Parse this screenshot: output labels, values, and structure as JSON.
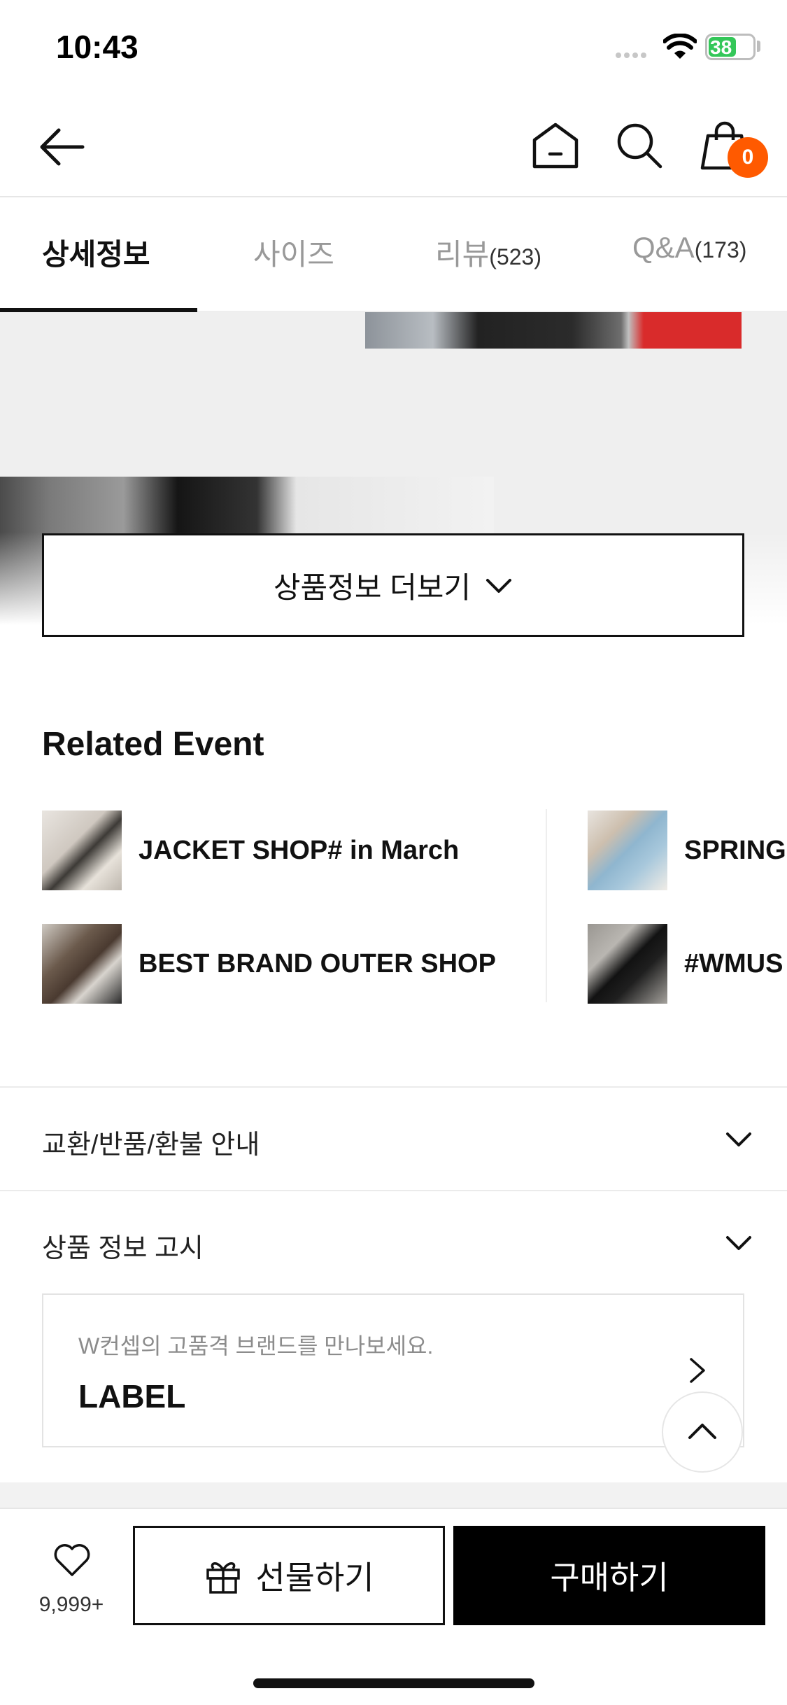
{
  "status_bar": {
    "time": "10:43",
    "battery": "38",
    "battery_level": 0.38
  },
  "cart": {
    "count": "0"
  },
  "tabs": [
    {
      "label": "상세정보",
      "count": ""
    },
    {
      "label": "사이즈",
      "count": ""
    },
    {
      "label": "리뷰",
      "count": "(523)"
    },
    {
      "label": "Q&A",
      "count": "(173)"
    }
  ],
  "more_button": {
    "label": "상품정보 더보기"
  },
  "related_event": {
    "title": "Related Event",
    "items": [
      {
        "title": "JACKET SHOP# in March"
      },
      {
        "title": "BEST BRAND OUTER SHOP"
      },
      {
        "title": "SPRING"
      },
      {
        "title": "#WMUS"
      }
    ]
  },
  "accordions": [
    {
      "label": "교환/반품/환불 안내"
    },
    {
      "label": "상품 정보 고시"
    }
  ],
  "brand_banner": {
    "subtitle": "W컨셉의 고품격 브랜드를 만나보세요.",
    "title": "LABEL"
  },
  "bottom_bar": {
    "like_count": "9,999+",
    "gift_label": "선물하기",
    "buy_label": "구매하기"
  },
  "colors": {
    "badge": "#ff5a00",
    "battery": "#34c759",
    "buy_bg": "#000000"
  }
}
